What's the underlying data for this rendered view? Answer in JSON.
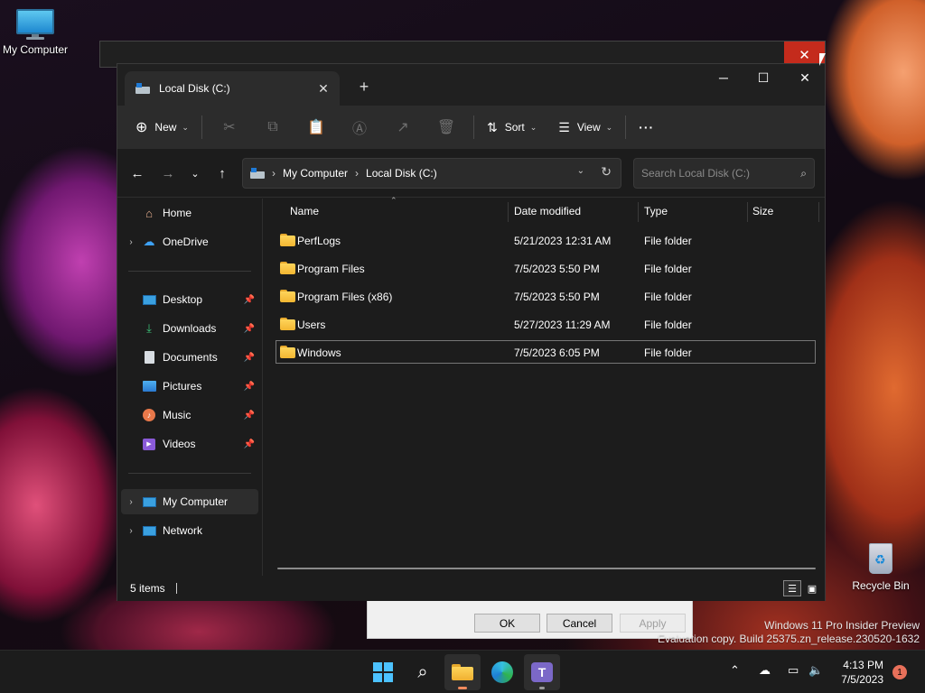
{
  "desktop": {
    "icons": [
      {
        "label": "My Computer"
      },
      {
        "label": "Recycle Bin"
      }
    ],
    "watermark_line1": "Windows 11 Pro Insider Preview",
    "watermark_line2": "Evaluation copy. Build 25375.zn_release.230520-1632"
  },
  "behind_dialog": {
    "ok_label": "OK",
    "cancel_label": "Cancel",
    "apply_label": "Apply"
  },
  "explorer": {
    "tab_title": "Local Disk (C:)",
    "toolbar": {
      "new_label": "New",
      "sort_label": "Sort",
      "view_label": "View",
      "more_label": "···"
    },
    "address": {
      "crumbs": [
        "My Computer",
        "Local Disk (C:)"
      ],
      "search_placeholder": "Search Local Disk (C:)"
    },
    "sidebar": {
      "home": "Home",
      "onedrive": "OneDrive",
      "quick": [
        "Desktop",
        "Downloads",
        "Documents",
        "Pictures",
        "Music",
        "Videos"
      ],
      "my_computer": "My Computer",
      "network": "Network"
    },
    "columns": {
      "name": "Name",
      "date": "Date modified",
      "type": "Type",
      "size": "Size"
    },
    "files": [
      {
        "name": "PerfLogs",
        "date": "5/21/2023 12:31 AM",
        "type": "File folder"
      },
      {
        "name": "Program Files",
        "date": "7/5/2023 5:50 PM",
        "type": "File folder"
      },
      {
        "name": "Program Files (x86)",
        "date": "7/5/2023 5:50 PM",
        "type": "File folder"
      },
      {
        "name": "Users",
        "date": "5/27/2023 11:29 AM",
        "type": "File folder"
      },
      {
        "name": "Windows",
        "date": "7/5/2023 6:05 PM",
        "type": "File folder"
      }
    ],
    "status": "5 items"
  },
  "taskbar": {
    "time": "4:13 PM",
    "date": "7/5/2023",
    "notifications": "1"
  }
}
